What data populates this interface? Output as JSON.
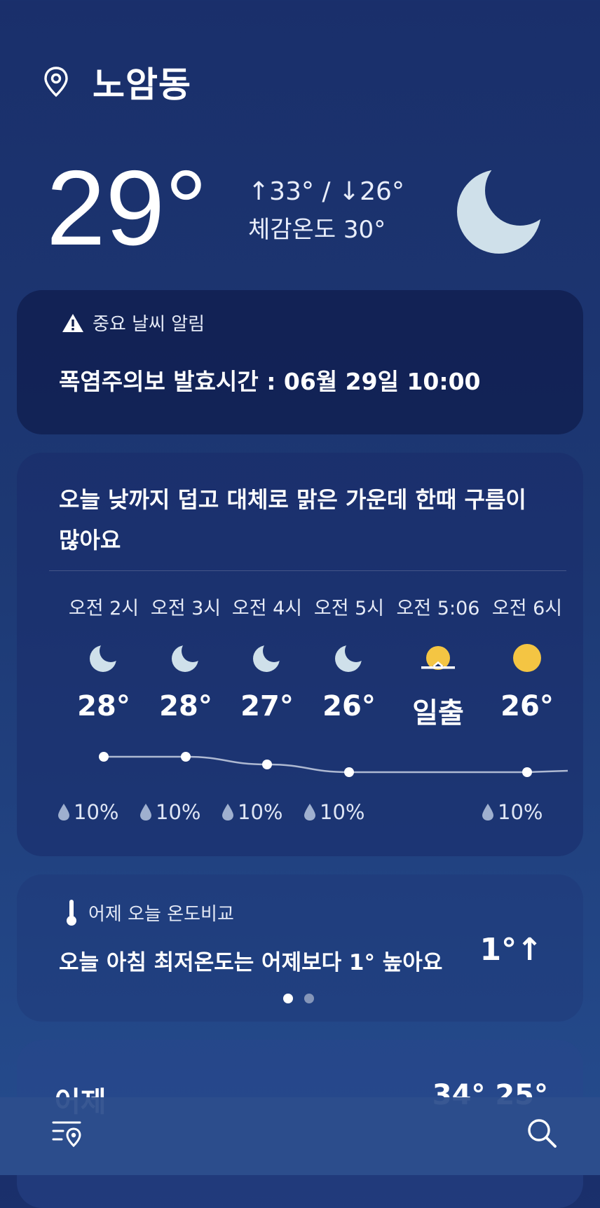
{
  "location": {
    "name": "노암동"
  },
  "current": {
    "temp": "29°",
    "hilo": "↑33° / ↓26°",
    "feels_like": "체감온도 30°",
    "icon": "moon-icon"
  },
  "alert": {
    "title": "중요 날씨 알림",
    "text": "폭염주의보  발효시간 : 06월 29일 10:00"
  },
  "forecast": {
    "summary": "오늘 낮까지 덥고 대체로 맑은 가운데 한때 구름이 많아요",
    "hours": [
      {
        "time": "오전 2시",
        "icon": "moon-icon",
        "temp": "28°",
        "temp_value": 28,
        "rain": "10%"
      },
      {
        "time": "오전 3시",
        "icon": "moon-icon",
        "temp": "28°",
        "temp_value": 28,
        "rain": "10%"
      },
      {
        "time": "오전 4시",
        "icon": "moon-icon",
        "temp": "27°",
        "temp_value": 27,
        "rain": "10%"
      },
      {
        "time": "오전 5시",
        "icon": "moon-icon",
        "temp": "26°",
        "temp_value": 26,
        "rain": "10%"
      },
      {
        "time": "오전 5:06",
        "icon": "sunrise-icon",
        "temp": "일출",
        "temp_value": null,
        "rain": ""
      },
      {
        "time": "오전 6시",
        "icon": "sun-icon",
        "temp": "26°",
        "temp_value": 26,
        "rain": "10%"
      }
    ]
  },
  "compare": {
    "title": "어제 오늘 온도비교",
    "text": "오늘 아침 최저온도는 어제보다 1° 높아요",
    "delta": "1°↑",
    "page_count": 2,
    "active_page": 1
  },
  "yesterday": {
    "label": "어제",
    "range": "34° 25°"
  },
  "colors": {
    "moon": "#cfe0ea",
    "sun": "#f4c543",
    "accent_line": "#aeb9d2"
  }
}
